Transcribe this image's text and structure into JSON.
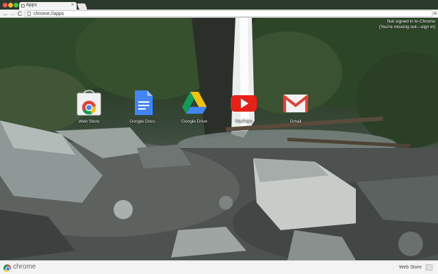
{
  "window": {
    "tab_title": "Apps",
    "tab_close_glyph": "×",
    "url": "chrome://apps"
  },
  "toolbar": {
    "back_glyph": "←",
    "forward_glyph": "→",
    "reload_glyph": "C",
    "menu_glyph": "≡"
  },
  "signin": {
    "line1": "Not signed in to Chrome",
    "line2": "(You're missing out—sign in)"
  },
  "apps": [
    {
      "label": "Web Store",
      "icon": "webstore-icon"
    },
    {
      "label": "Google Docs",
      "icon": "docs-icon"
    },
    {
      "label": "Google Drive",
      "icon": "drive-icon"
    },
    {
      "label": "YouTube",
      "icon": "youtube-icon"
    },
    {
      "label": "Gmail",
      "icon": "gmail-icon"
    }
  ],
  "bottom": {
    "brand": "chrome",
    "webstore_link": "Web Store"
  },
  "colors": {
    "docs_blue": "#4285f4",
    "youtube_red": "#e62117",
    "gmail_red": "#db4437",
    "drive_green": "#0f9d58",
    "drive_yellow": "#f4c20d"
  }
}
